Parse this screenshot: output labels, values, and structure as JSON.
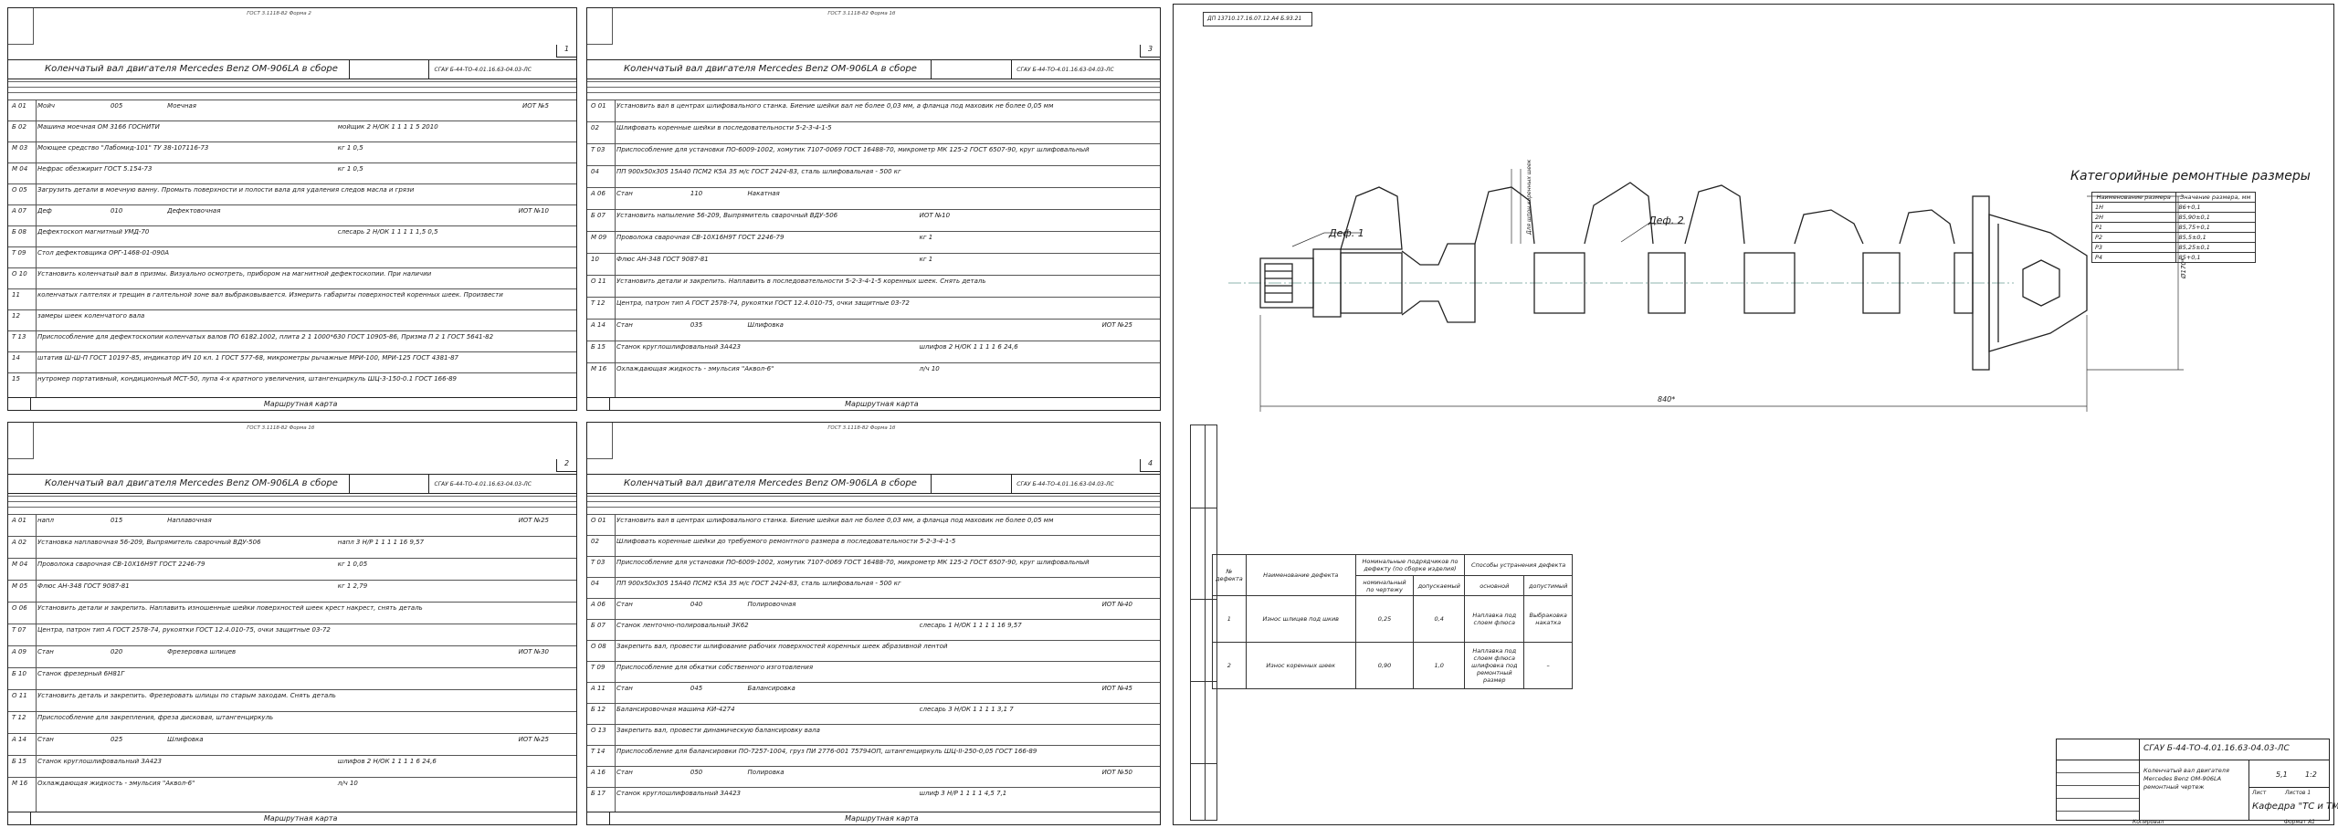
{
  "cards": [
    {
      "std": "ГОСТ 3.1118-82 Форма 2",
      "sheet_no": "1",
      "title": "Коленчатый вал двигателя Mercedes Benz OM-906LA в сборе",
      "code": "СГАУ Б-44-ТО-4.01.16.63-04.03-ЛС",
      "rows": [
        [
          "А 01",
          "Мойч",
          "005",
          "Моечная",
          "ИОТ №5"
        ],
        [
          "Б 02",
          "Машина моечная ОМ 3166 ГОСНИТИ",
          "мойщик  2  Н/ОК  1  1  1  1  5  2010"
        ],
        [
          "М 03",
          "Моющее средство \"Лабомид-101\" ТУ 38-107116-73",
          "кг  1  0,5"
        ],
        [
          "М 04",
          "Нефрас обезжирит ГОСТ 5.154-73",
          "кг  1  0,5"
        ],
        [
          "О 05",
          "Загрузить детали в моечную ванну. Промыть поверхности и полости вала для удаления следов масла и грязи",
          ""
        ],
        [
          "А 07",
          "Деф",
          "010",
          "Дефектовочная",
          "ИОТ №10"
        ],
        [
          "Б 08",
          "Дефектоскоп магнитный УМД-70",
          "слесарь  2  Н/ОК  1  1  1  1  1,5  0,5"
        ],
        [
          "Т 09",
          "Стол дефектовщика ОРГ-1468-01-090А",
          ""
        ],
        [
          "О 10",
          "Установить коленчатый вал в призмы. Визуально осмотреть, прибором на магнитной дефектоскопии. При наличии",
          ""
        ],
        [
          "11",
          "коленчатых галтелях и трещин в галтельной зоне вал выбраковывается. Измерить габариты поверхностей коренных шеек. Произвести",
          ""
        ],
        [
          "12",
          "замеры шеек коленчатого вала",
          ""
        ],
        [
          "Т 13",
          "Приспособление для дефектоскопии коленчатых валов ПО 6182.1002, плита 2 1 1000*630 ГОСТ 10905-86, Призма П 2 1 ГОСТ 5641-82",
          ""
        ],
        [
          "14",
          "штатив Ш-Ш-П ГОСТ 10197-85, индикатор ИЧ 10 кл. 1 ГОСТ 577-68, микрометры рычажные МРИ-100, МРИ-125 ГОСТ 4381-87",
          ""
        ],
        [
          "15",
          "нутромер портативный, кондиционный МСТ-50, лупа 4-х кратного увеличения, штангенциркуль ШЦ-3-150-0.1 ГОСТ 166-89",
          ""
        ]
      ],
      "footer": "Маршрутная карта"
    },
    {
      "std": "ГОСТ 3.1118-82 Форма 1б",
      "sheet_no": "3",
      "title": "Коленчатый вал двигателя Mercedes Benz OM-906LA в сборе",
      "code": "СГАУ Б-44-ТО-4.01.16.63-04.03-ЛС",
      "rows": [
        [
          "О 01",
          "Установить вал в центрах шлифовального станка. Биение шейки вал не более 0,03 мм, а фланца под маховик не более 0,05 мм",
          ""
        ],
        [
          "02",
          "Шлифовать коренные шейки в последовательности 5-2-3-4-1-5",
          ""
        ],
        [
          "Т 03",
          "Приспособление для установки ПО-6009-1002, хомутик 7107-0069 ГОСТ 16488-70, микрометр МК 125-2 ГОСТ 6507-90, круг шлифовальный",
          ""
        ],
        [
          "04",
          "ПП 900х50х305 15А40 ПСМ2 К5А 35 м/с ГОСТ 2424-83, сталь шлифовальная - 500 кг",
          ""
        ],
        [
          "А 06",
          "Стан",
          "110",
          "Накатная",
          ""
        ],
        [
          "Б 07",
          "Установить напыление 56-209, Выпрямитель сварочный ВДУ-506",
          "ИОТ №10"
        ],
        [
          "М 09",
          "Проволока сварочная СВ-10Х16Н9Т ГОСТ 2246-79",
          "кг  1"
        ],
        [
          "10",
          "Флюс АН-348 ГОСТ 9087-81",
          "кг  1"
        ],
        [
          "О 11",
          "Установить детали и закрепить. Наплавить в последовательности 5-2-3-4-1-5 коренных шеек. Снять деталь",
          ""
        ],
        [
          "Т 12",
          "Центра, патрон тип А ГОСТ 2578-74, рукоятки ГОСТ 12.4.010-75, очки защитные 03-72",
          ""
        ],
        [
          "А 14",
          "Стан",
          "035",
          "Шлифовка",
          "ИОТ №25"
        ],
        [
          "Б 15",
          "Станок круглошлифовальный 3А423",
          "шлифов  2  Н/ОК  1  1  1  1  6  24,6"
        ],
        [
          "М 16",
          "Охлаждающая жидкость - эмульсия \"Аквол-6\"",
          "л/ч  10"
        ]
      ],
      "footer": "Маршрутная карта"
    },
    {
      "std": "ГОСТ 3.1118-82 Форма 1б",
      "sheet_no": "2",
      "title": "Коленчатый вал двигателя Mercedes Benz OM-906LA в сборе",
      "code": "СГАУ Б-44-ТО-4.01.16.63-04.03-ЛС",
      "rows": [
        [
          "А 01",
          "напл",
          "015",
          "Наплавочная",
          "ИОТ №25"
        ],
        [
          "А 02",
          "Установка наплавочная 56-209, Выпрямитель сварочный ВДУ-506",
          "напл  3  Н/Р  1  1  1  1  16  9,57"
        ],
        [
          "М 04",
          "Проволока сварочная СВ-10Х16Н9Т ГОСТ 2246-79",
          "кг  1  0,05"
        ],
        [
          "М 05",
          "Флюс АН-348 ГОСТ 9087-81",
          "кг  1  2,79"
        ],
        [
          "О 06",
          "Установить детали и закрепить. Наплавить изношенные шейки поверхностей шеек крест накрест, снять деталь",
          ""
        ],
        [
          "Т 07",
          "Центра, патрон тип А ГОСТ 2578-74, рукоятки ГОСТ 12.4.010-75, очки защитные 03-72",
          ""
        ],
        [
          "А 09",
          "Стан",
          "020",
          "Фрезеровка шлицев",
          "ИОТ №30"
        ],
        [
          "Б 10",
          "Станок фрезерный 6Н81Г",
          ""
        ],
        [
          "О 11",
          "Установить деталь и закрепить. Фрезеровать шлицы по старым заходам. Снять деталь",
          ""
        ],
        [
          "Т 12",
          "Приспособление для закрепления, фреза дисковая, штангенциркуль",
          ""
        ],
        [
          "А 14",
          "Стан",
          "025",
          "Шлифовка",
          "ИОТ №25"
        ],
        [
          "Б 15",
          "Станок круглошлифовальный 3А423",
          "шлифов  2  Н/ОК  1  1  1  1  6  24,6"
        ],
        [
          "М 16",
          "Охлаждающая жидкость - эмульсия \"Аквол-6\"",
          "л/ч  10"
        ]
      ],
      "footer": "Маршрутная карта"
    },
    {
      "std": "ГОСТ 3.1118-82 Форма 1б",
      "sheet_no": "4",
      "title": "Коленчатый вал двигателя Mercedes Benz OM-906LA в сборе",
      "code": "СГАУ Б-44-ТО-4.01.16.63-04.03-ЛС",
      "rows": [
        [
          "О 01",
          "Установить вал в центрах шлифовального станка. Биение шейки вал не более 0,03 мм, а фланца под маховик не более 0,05 мм",
          ""
        ],
        [
          "02",
          "Шлифовать коренные шейки до требуемого ремонтного размера в последовательности 5-2-3-4-1-5",
          ""
        ],
        [
          "Т 03",
          "Приспособление для установки ПО-6009-1002, хомутик 7107-0069 ГОСТ 16488-70, микрометр МК 125-2 ГОСТ 6507-90, круг шлифовальный",
          ""
        ],
        [
          "04",
          "ПП 900х50х305 15А40 ПСМ2 К5А 35 м/с ГОСТ 2424-83, сталь шлифовальная - 500 кг",
          ""
        ],
        [
          "А 06",
          "Стан",
          "040",
          "Полировочная",
          "ИОТ №40"
        ],
        [
          "Б 07",
          "Станок ленточно-полировальный 3К62",
          "слесарь  1  Н/ОК  1  1  1  1  16  9,57"
        ],
        [
          "О 08",
          "Закрепить вал, провести шлифование рабочих поверхностей коренных шеек абразивной лентой",
          ""
        ],
        [
          "Т 09",
          "Приспособление для обкатки собственного изготовления",
          ""
        ],
        [
          "А 11",
          "Стан",
          "045",
          "Балансировка",
          "ИОТ №45"
        ],
        [
          "Б 12",
          "Балансировочная машина КИ-4274",
          "слесарь  3  Н/ОК  1  1  1  1  3,1  7"
        ],
        [
          "О 13",
          "Закрепить вал, провести динамическую балансировку вала",
          ""
        ],
        [
          "Т 14",
          "Приспособление для балансировки ПО-7257-1004, груз ПИ 2776-001 75794ОП, штангенциркуль ШЦ-II-250-0,05 ГОСТ 166-89",
          ""
        ],
        [
          "А 16",
          "Стан",
          "050",
          "Полировка",
          "ИОТ №50"
        ],
        [
          "Б 17",
          "Станок круглошлифовальный 3А423",
          "шлиф  3  Н/Р  1  1  1  1  4,5  7,1"
        ]
      ],
      "footer": "Маршрутная карта"
    }
  ],
  "drawing": {
    "stamp_code": "ДП 13710.17.16.07.12.А4 Б.93.21",
    "def1": "Деф. 1",
    "def2": "Деф. 2",
    "dim_len": "840*",
    "dim_h": "Ø170*",
    "side_label": "Для шпон коренных шеек",
    "table_title": "Категорийные ремонтные размеры",
    "size_table": {
      "headers": [
        "Наименование размера",
        "Значение размера, мм"
      ],
      "rows": [
        [
          "1Н",
          "86+0,1"
        ],
        [
          "2Н",
          "85,90±0,1"
        ],
        [
          "Р1",
          "85,75+0,1"
        ],
        [
          "Р2",
          "85,5±0,1"
        ],
        [
          "Р3",
          "85,25±0,1"
        ],
        [
          "Р4",
          "85+0,1"
        ]
      ]
    },
    "defect_table": {
      "h_no": "№ дефекта",
      "h_name": "Наименование дефекта",
      "h_size": "Номинальные подрядчиков по дефекту (по сборке изделия)",
      "h_nom": "номинальный по чертежу",
      "h_allow": "допускаемый",
      "h_method": "Способы устранения дефекта",
      "h_main": "основной",
      "h_alt": "допустимый",
      "rows": [
        [
          "1",
          "Износ шлицев под шкив",
          "0,25",
          "0,4",
          "Наплавка под слоем флюса",
          "Выбраковка накатка"
        ],
        [
          "2",
          "Износ коренных шеек",
          "0,90",
          "1,0",
          "Наплавка под слоем флюса шлифовка под ремонтный размер",
          "–"
        ]
      ]
    },
    "title_block": {
      "code": "СГАУ Б-44-ТО-4.01.16.63-04.03-ЛС",
      "name": "Коленчатый вал двигателя Mercedes Benz OM-906LA ремонтный чертеж",
      "sheet": "Лист",
      "sheets": "Листов 1",
      "mass": "5,1",
      "scale": "1:2",
      "org": "Кафедра \"ТС и ТМ\"",
      "copied": "Копировал",
      "format": "Формат А1"
    }
  }
}
